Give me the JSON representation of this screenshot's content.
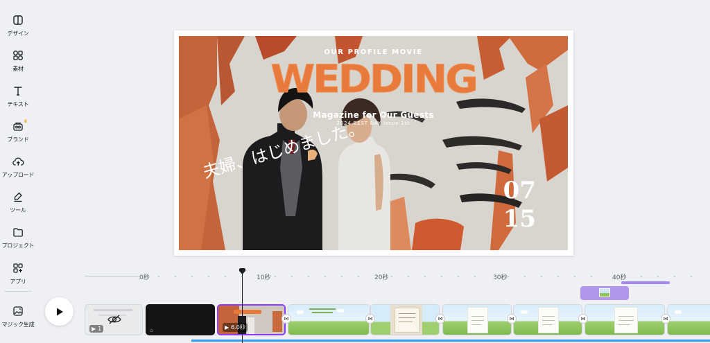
{
  "sidebar": {
    "items": [
      {
        "label": "デザイン",
        "icon": "layout-icon"
      },
      {
        "label": "素材",
        "icon": "shapes-icon"
      },
      {
        "label": "テキスト",
        "icon": "text-icon"
      },
      {
        "label": "ブランド",
        "icon": "brand-icon"
      },
      {
        "label": "アップロード",
        "icon": "cloud-upload-icon"
      },
      {
        "label": "ツール",
        "icon": "pen-tool-icon"
      },
      {
        "label": "プロジェクト",
        "icon": "folder-icon"
      },
      {
        "label": "アプリ",
        "icon": "apps-grid-icon"
      },
      {
        "label": "マジック生成",
        "icon": "magic-media-icon"
      }
    ]
  },
  "design": {
    "profile_line": "OUR PROFILE MOVIE",
    "headline": "WEDDING",
    "magazine_line": "Magazine for Our Guests",
    "issue_line": "2024 BEST DAY Issue 1st",
    "handwritten": "夫婦、はじめました。",
    "month": "07",
    "day": "15",
    "headline_color": "#E87A3C"
  },
  "timeline": {
    "ticks": [
      "0秒",
      "10秒",
      "20秒",
      "30秒",
      "40秒"
    ],
    "clips": [
      {
        "badge": "1",
        "type": "hidden"
      },
      {
        "badge": "",
        "type": "dark"
      },
      {
        "badge": "6.0秒",
        "type": "selected"
      },
      {
        "badge": "",
        "type": "landscape"
      },
      {
        "badge": "",
        "type": "card-tan"
      },
      {
        "badge": "",
        "type": "landscape-card"
      },
      {
        "badge": "",
        "type": "landscape-card"
      },
      {
        "badge": "",
        "type": "landscape-card"
      },
      {
        "badge": "",
        "type": "landscape-card"
      }
    ],
    "accent_color": "#8B3DFF",
    "progress_color": "#2F9EF5"
  }
}
